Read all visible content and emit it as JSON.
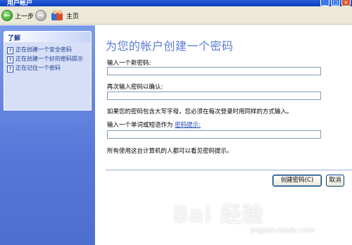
{
  "window": {
    "title": "用户帐户",
    "caption_buttons": [
      "_",
      "□",
      "×"
    ]
  },
  "toolbar": {
    "back_label": "上一步",
    "home_label": "主页",
    "back_glyph": "←",
    "forward_glyph": "→"
  },
  "sidebar": {
    "header": "了解",
    "items": [
      {
        "label": "正在创建一个安全密码",
        "icon": "help-icon"
      },
      {
        "label": "正在创建一个好的密码提示",
        "icon": "help-icon"
      },
      {
        "label": "正在记住一个密码",
        "icon": "help-icon"
      }
    ]
  },
  "main": {
    "heading": "为您的帐户创建一个密码",
    "new_password_label": "输入一个新密码:",
    "new_password_value": "",
    "confirm_password_label": "再次输入密码以确认:",
    "confirm_password_value": "",
    "case_note": "如果您的密码包含大写字母，您必须在每次登录时用同样的方式输入。",
    "hint_label_prefix": "输入一个单词或短语作为",
    "hint_link": "密码提示:",
    "hint_value": "",
    "hint_note": "所有使用这台计算机的人都可以看见密码提示。",
    "create_button": "创建密码(C)",
    "cancel_button": "取消"
  },
  "watermark": {
    "text": "Bai 经验",
    "url": "jingyan.baidu.com"
  },
  "colors": {
    "title_bar": "#0a3ec0",
    "sidebar": "#5677d8",
    "heading": "#5a7bd0",
    "link": "#2146b8"
  }
}
